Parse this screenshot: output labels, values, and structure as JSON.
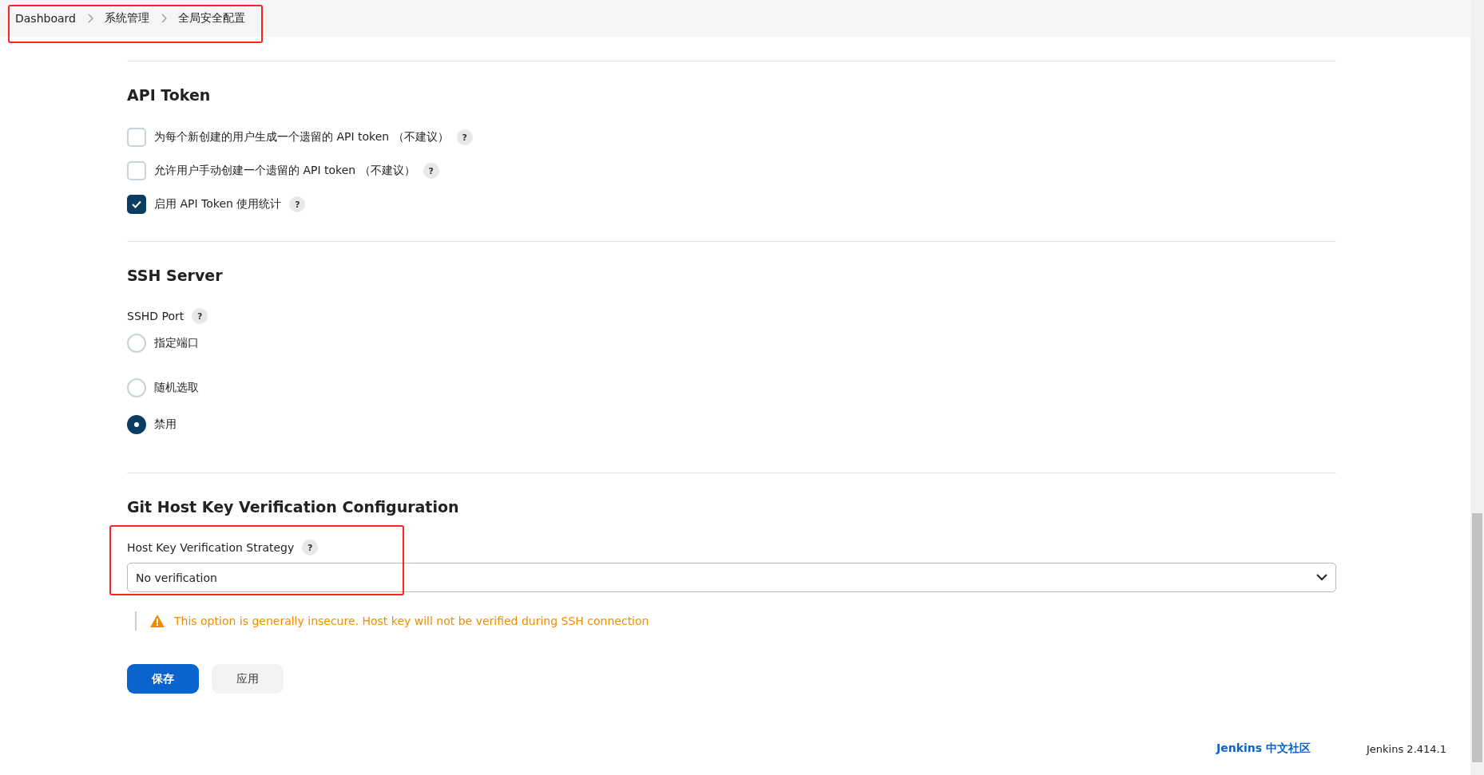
{
  "breadcrumb": [
    {
      "label": "Dashboard"
    },
    {
      "label": "系统管理"
    },
    {
      "label": "全局安全配置"
    }
  ],
  "sections": [
    {
      "kind": "checkboxes",
      "title": "API Token",
      "items": [
        {
          "label": "为每个新创建的用户生成一个遗留的 API token （不建议）",
          "checked": false,
          "help": "?"
        },
        {
          "label": "允许用户手动创建一个遗留的 API token （不建议）",
          "checked": false,
          "help": "?"
        },
        {
          "label": "启用 API Token 使用统计",
          "checked": true,
          "help": "?"
        }
      ]
    },
    {
      "kind": "radios",
      "title": "SSH Server",
      "field_label": "SSHD Port",
      "help": "?",
      "options": [
        {
          "label": "指定端口",
          "selected": false
        },
        {
          "label": "随机选取",
          "selected": false
        },
        {
          "label": "禁用",
          "selected": true
        }
      ]
    },
    {
      "kind": "select",
      "title": "Git Host Key Verification Configuration",
      "field_label": "Host Key Verification Strategy",
      "help": "?",
      "value": "No verification",
      "warning": "This option is generally insecure. Host key will not be verified during SSH connection"
    }
  ],
  "buttons": [
    {
      "label": "保存",
      "kind": "primary"
    },
    {
      "label": "应用",
      "kind": "secondary"
    }
  ],
  "footer": {
    "link": "Jenkins 中文社区",
    "version": "Jenkins 2.414.1"
  }
}
